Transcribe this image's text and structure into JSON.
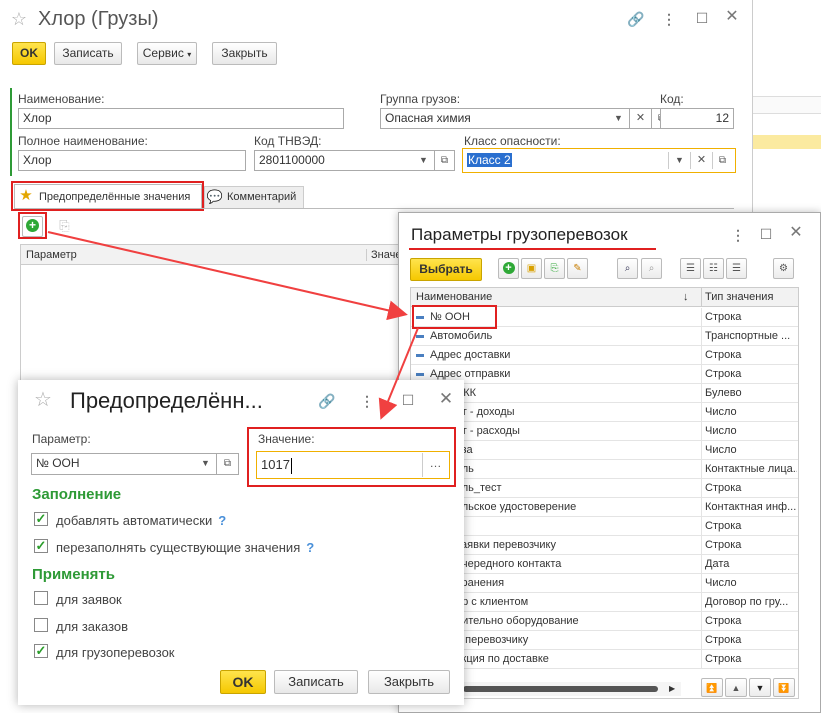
{
  "main": {
    "title": "Хлор (Грузы)",
    "toolbar": {
      "ok": "OK",
      "save": "Записать",
      "service": "Сервис",
      "close": "Закрыть"
    },
    "fields": {
      "name_label": "Наименование:",
      "name_value": "Хлор",
      "group_label": "Группа грузов:",
      "group_value": "Опасная химия",
      "code_label": "Код:",
      "code_value": "12",
      "fullname_label": "Полное наименование:",
      "fullname_value": "Хлор",
      "tnved_label": "Код ТНВЭД:",
      "tnved_value": "2801100000",
      "class_label": "Класс опасности:",
      "class_value": "Класс 2"
    },
    "tabs": [
      "Предопределённые значения",
      "Комментарий"
    ],
    "table_headers": [
      "Параметр",
      "Значение"
    ]
  },
  "params": {
    "title": "Параметры грузоперевозок",
    "choose": "Выбрать",
    "col_name": "Наименование",
    "col_type": "Тип значения",
    "rows": [
      {
        "name": "№ ООН",
        "type": "Строка"
      },
      {
        "name": "Автомобиль",
        "type": "Транспортные ..."
      },
      {
        "name": "Адрес доставки",
        "type": "Строка"
      },
      {
        "name": "Адрес отправки",
        "type": "Строка"
      },
      {
        "name": "ЛКК",
        "type": "Булево"
      },
      {
        "name": "ет - доходы",
        "type": "Число"
      },
      {
        "name": "ет - расходы",
        "type": "Число"
      },
      {
        "name": "уза",
        "type": "Число"
      },
      {
        "name": "ель",
        "type": "Контактные лица..."
      },
      {
        "name": "ель_тест",
        "type": "Строка"
      },
      {
        "name": "ельское удостоверение",
        "type": "Контактная инф..."
      },
      {
        "name": "",
        "type": "Строка"
      },
      {
        "name": "заявки перевозчику",
        "type": "Строка"
      },
      {
        "name": "очередного контакта",
        "type": "Дата"
      },
      {
        "name": "хранения",
        "type": "Число"
      },
      {
        "name": "ор с клиентом",
        "type": "Договор по гру..."
      },
      {
        "name": "нительно оборудование",
        "type": "Строка"
      },
      {
        "name": "а перевозчику",
        "type": "Строка"
      },
      {
        "name": "укция по доставке",
        "type": "Строка"
      }
    ]
  },
  "predef": {
    "title": "Предопределённ...",
    "param_label": "Параметр:",
    "param_value": "№ ООН",
    "value_label": "Значение:",
    "value_value": "1017",
    "fill_heading": "Заполнение",
    "fill_auto": "добавлять автоматически",
    "fill_refill": "перезаполнять существующие значения",
    "apply_heading": "Применять",
    "apply_requests": "для заявок",
    "apply_orders": "для заказов",
    "apply_cargo": "для грузоперевозок",
    "help": "?",
    "ok": "OK",
    "save": "Записать",
    "close": "Закрыть",
    "checks": {
      "fill_auto": true,
      "fill_refill": true,
      "apply_requests": false,
      "apply_orders": false,
      "apply_cargo": true
    }
  },
  "colors": {
    "accent_red": "#e02020",
    "yellow": "#f5c800",
    "green": "#2e9a36"
  }
}
